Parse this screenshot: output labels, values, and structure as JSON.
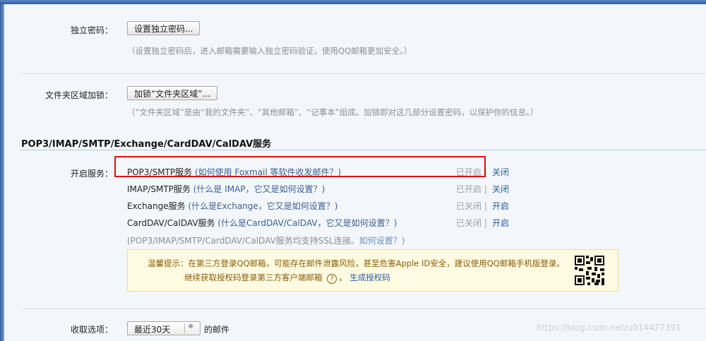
{
  "independent_password": {
    "label": "独立密码：",
    "button": "设置独立密码...",
    "hint": "（设置独立密码后，进入邮箱需要输入独立密码验证，使用QQ邮箱更加安全。）"
  },
  "folder_lock": {
    "label": "文件夹区域加锁：",
    "button": "加锁“文件夹区域”...",
    "hint": "（“文件夹区域”是由“我的文件夹”、“其他邮箱”、“记事本”组成。加锁即对这几部分设置密码，以保护你的信息。）"
  },
  "services": {
    "title": "POP3/IMAP/SMTP/Exchange/CardDAV/CalDAV服务",
    "label": "开启服务：",
    "rows": [
      {
        "name": "POP3/SMTP服务",
        "link": "(如何使用 Foxmail 等软件收发邮件？)",
        "state": "已开启",
        "sep": "|",
        "action": "关闭"
      },
      {
        "name": "IMAP/SMTP服务",
        "link": "(什么是 IMAP，它又是如何设置？)",
        "state": "已开启",
        "sep": "|",
        "action": "关闭"
      },
      {
        "name": "Exchange服务",
        "link": "(什么是Exchange，它又是如何设置？)",
        "state": "已关闭",
        "sep": "|",
        "action": "开启"
      },
      {
        "name": "CardDAV/CalDAV服务",
        "link": "(什么是CardDAV/CalDAV，它又是如何设置？)",
        "state": "已关闭",
        "sep": "|",
        "action": "开启"
      }
    ],
    "ssl_note_prefix": "(POP3/IMAP/SMTP/CardDAV/CalDAV服务均支持SSL连接。",
    "ssl_note_link": "如何设置？",
    "ssl_note_suffix": ")",
    "tip": {
      "line1": "温馨提示：在第三方登录QQ邮箱，可能存在邮件泄露风险，甚至危害Apple ID安全，建议使用QQ邮箱手机版登录。",
      "line2_prefix": "继续获取授权码登录第三方客户端邮箱",
      "help_symbol": "?",
      "line2_sep": "。",
      "generate_link": "生成授权码"
    }
  },
  "receive_options": {
    "label": "收取选项：",
    "select_value": "最近30天",
    "select_arrow": "≑",
    "suffix": "的邮件"
  },
  "watermark": "https://blog.csdn.net/u014427391"
}
